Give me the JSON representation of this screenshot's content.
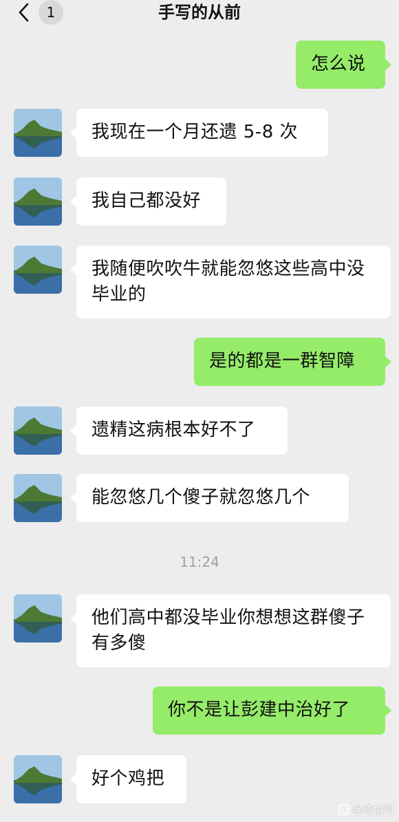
{
  "header": {
    "title": "手写的从前",
    "unread_count": "1"
  },
  "messages": [
    {
      "side": "out",
      "text": "怎么说"
    },
    {
      "side": "in",
      "text": "我现在一个月还遗 5-8 次"
    },
    {
      "side": "in",
      "text": "我自己都没好"
    },
    {
      "side": "in",
      "text": "我随便吹吹牛就能忽悠这些高中没毕业的"
    },
    {
      "side": "out",
      "text": "是的都是一群智障"
    },
    {
      "side": "in",
      "text": "遗精这病根本好不了"
    },
    {
      "side": "in",
      "text": "能忽悠几个傻子就忽悠几个"
    },
    {
      "side": "in",
      "text": "他们高中都没毕业你想想这群傻子有多傻"
    },
    {
      "side": "out",
      "text": "你不是让彭建中治好了"
    },
    {
      "side": "in",
      "text": "好个鸡把"
    }
  ],
  "timestamp": "11:24",
  "watermark": "@戒色吧",
  "icons": {
    "back": "chevron-left-icon",
    "avatar": "landscape-avatar",
    "watermark": "camera-icon"
  },
  "colors": {
    "background": "#ededed",
    "incoming_bubble": "#ffffff",
    "outgoing_bubble": "#95ec69",
    "timestamp": "#a0a0a0"
  }
}
